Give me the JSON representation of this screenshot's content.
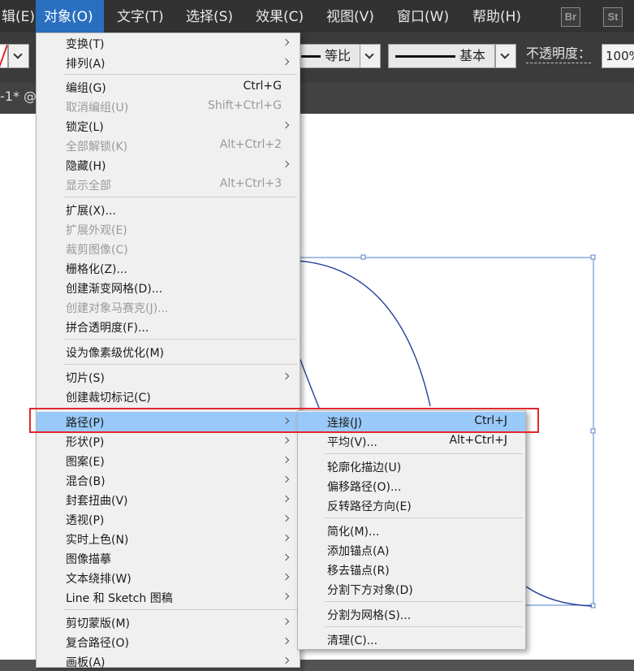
{
  "menubar": {
    "items": [
      {
        "label": "辑(E)",
        "active": false
      },
      {
        "label": "对象(O)",
        "active": true
      },
      {
        "label": "文字(T)",
        "active": false
      },
      {
        "label": "选择(S)",
        "active": false
      },
      {
        "label": "效果(C)",
        "active": false
      },
      {
        "label": "视图(V)",
        "active": false
      },
      {
        "label": "窗口(W)",
        "active": false
      },
      {
        "label": "帮助(H)",
        "active": false
      }
    ],
    "bridge_badge": "Br",
    "stock_badge": "St"
  },
  "controlbar": {
    "profile_label": "等比",
    "stroke_style_label": "基本",
    "opacity_label": "不透明度",
    "opacity_colon": "：",
    "opacity_value": "100%"
  },
  "tabbar": {
    "doc_tab": "-1* @"
  },
  "object_menu": {
    "items": [
      {
        "label": "变换(T)",
        "shortcut": "",
        "submenu": true,
        "disabled": false
      },
      {
        "label": "排列(A)",
        "shortcut": "",
        "submenu": true,
        "disabled": false
      },
      {
        "label": "编组(G)",
        "shortcut": "Ctrl+G",
        "submenu": false,
        "disabled": false
      },
      {
        "label": "取消编组(U)",
        "shortcut": "Shift+Ctrl+G",
        "submenu": false,
        "disabled": true
      },
      {
        "label": "锁定(L)",
        "shortcut": "",
        "submenu": true,
        "disabled": false
      },
      {
        "label": "全部解锁(K)",
        "shortcut": "Alt+Ctrl+2",
        "submenu": false,
        "disabled": true
      },
      {
        "label": "隐藏(H)",
        "shortcut": "",
        "submenu": true,
        "disabled": false
      },
      {
        "label": "显示全部",
        "shortcut": "Alt+Ctrl+3",
        "submenu": false,
        "disabled": true
      },
      {
        "label": "扩展(X)...",
        "shortcut": "",
        "submenu": false,
        "disabled": false
      },
      {
        "label": "扩展外观(E)",
        "shortcut": "",
        "submenu": false,
        "disabled": true
      },
      {
        "label": "裁剪图像(C)",
        "shortcut": "",
        "submenu": false,
        "disabled": true
      },
      {
        "label": "栅格化(Z)...",
        "shortcut": "",
        "submenu": false,
        "disabled": false
      },
      {
        "label": "创建渐变网格(D)...",
        "shortcut": "",
        "submenu": false,
        "disabled": false
      },
      {
        "label": "创建对象马赛克(J)...",
        "shortcut": "",
        "submenu": false,
        "disabled": true
      },
      {
        "label": "拼合透明度(F)...",
        "shortcut": "",
        "submenu": false,
        "disabled": false
      },
      {
        "label": "设为像素级优化(M)",
        "shortcut": "",
        "submenu": false,
        "disabled": false
      },
      {
        "label": "切片(S)",
        "shortcut": "",
        "submenu": true,
        "disabled": false
      },
      {
        "label": "创建裁切标记(C)",
        "shortcut": "",
        "submenu": false,
        "disabled": false
      },
      {
        "label": "路径(P)",
        "shortcut": "",
        "submenu": true,
        "disabled": false,
        "highlighted": true
      },
      {
        "label": "形状(P)",
        "shortcut": "",
        "submenu": true,
        "disabled": false
      },
      {
        "label": "图案(E)",
        "shortcut": "",
        "submenu": true,
        "disabled": false
      },
      {
        "label": "混合(B)",
        "shortcut": "",
        "submenu": true,
        "disabled": false
      },
      {
        "label": "封套扭曲(V)",
        "shortcut": "",
        "submenu": true,
        "disabled": false
      },
      {
        "label": "透视(P)",
        "shortcut": "",
        "submenu": true,
        "disabled": false
      },
      {
        "label": "实时上色(N)",
        "shortcut": "",
        "submenu": true,
        "disabled": false
      },
      {
        "label": "图像描摹",
        "shortcut": "",
        "submenu": true,
        "disabled": false
      },
      {
        "label": "文本绕排(W)",
        "shortcut": "",
        "submenu": true,
        "disabled": false
      },
      {
        "label": "Line 和 Sketch 图稿",
        "shortcut": "",
        "submenu": true,
        "disabled": false
      },
      {
        "label": "剪切蒙版(M)",
        "shortcut": "",
        "submenu": true,
        "disabled": false
      },
      {
        "label": "复合路径(O)",
        "shortcut": "",
        "submenu": true,
        "disabled": false
      },
      {
        "label": "画板(A)",
        "shortcut": "",
        "submenu": true,
        "disabled": false
      }
    ]
  },
  "path_submenu": {
    "items": [
      {
        "label": "连接(J)",
        "shortcut": "Ctrl+J",
        "highlighted": true
      },
      {
        "label": "平均(V)...",
        "shortcut": "Alt+Ctrl+J"
      },
      {
        "label": "轮廓化描边(U)",
        "shortcut": ""
      },
      {
        "label": "偏移路径(O)...",
        "shortcut": ""
      },
      {
        "label": "反转路径方向(E)",
        "shortcut": ""
      },
      {
        "label": "简化(M)...",
        "shortcut": ""
      },
      {
        "label": "添加锚点(A)",
        "shortcut": ""
      },
      {
        "label": "移去锚点(R)",
        "shortcut": ""
      },
      {
        "label": "分割下方对象(D)",
        "shortcut": ""
      },
      {
        "label": "分割为网格(S)...",
        "shortcut": ""
      },
      {
        "label": "清理(C)...",
        "shortcut": ""
      }
    ]
  },
  "colors": {
    "menubar_bg": "#323232",
    "active_menu": "#2a6fbf",
    "menu_bg": "#f0f0f0",
    "menu_highlight": "#99c9f8",
    "annotation_red": "#e0282e",
    "path_stroke": "#2b3e9a",
    "bbox_stroke": "#4f7fd0"
  }
}
